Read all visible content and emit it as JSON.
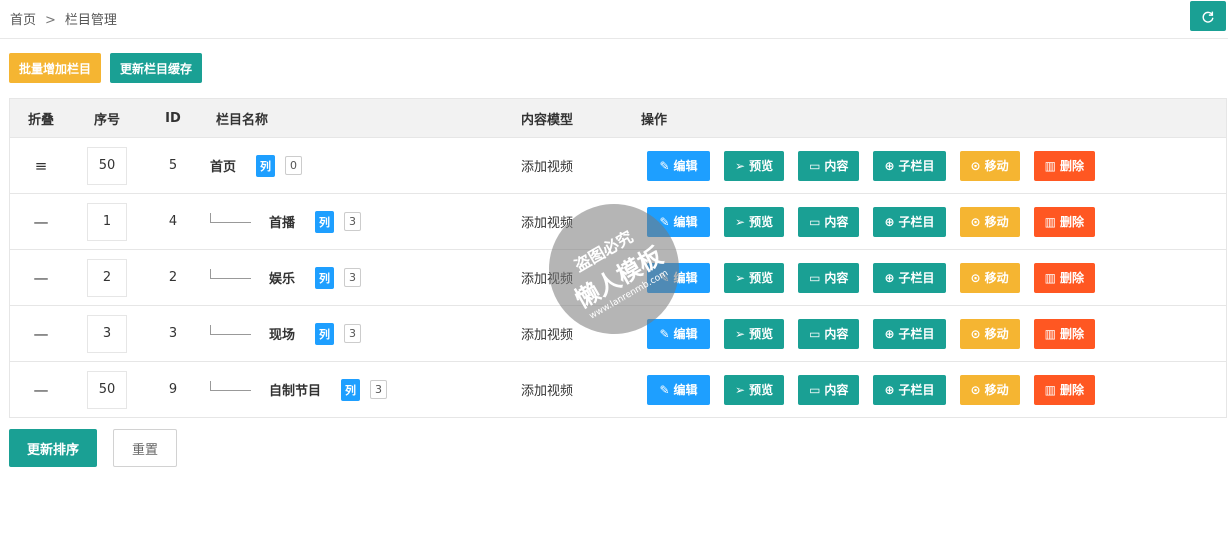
{
  "breadcrumb": {
    "home": "首页",
    "separator": ">",
    "current": "栏目管理"
  },
  "toolbar": {
    "batch_add": "批量增加栏目",
    "refresh_cache": "更新栏目缓存"
  },
  "table": {
    "headers": {
      "fold": "折叠",
      "order": "序号",
      "id": "ID",
      "name": "栏目名称",
      "model": "内容模型",
      "ops": "操作"
    },
    "rows": [
      {
        "fold": "≡",
        "order": "50",
        "id": "5",
        "name": "首页",
        "tag": "列",
        "count": "0",
        "model": "添加视频",
        "child": false
      },
      {
        "fold": "—",
        "order": "1",
        "id": "4",
        "name": "首播",
        "tag": "列",
        "count": "3",
        "model": "添加视频",
        "child": true
      },
      {
        "fold": "—",
        "order": "2",
        "id": "2",
        "name": "娱乐",
        "tag": "列",
        "count": "3",
        "model": "添加视频",
        "child": true
      },
      {
        "fold": "—",
        "order": "3",
        "id": "3",
        "name": "现场",
        "tag": "列",
        "count": "3",
        "model": "添加视频",
        "child": true
      },
      {
        "fold": "—",
        "order": "50",
        "id": "9",
        "name": "自制节目",
        "tag": "列",
        "count": "3",
        "model": "添加视频",
        "child": true
      }
    ]
  },
  "ops": {
    "edit": "编辑",
    "preview": "预览",
    "content": "内容",
    "sub": "子栏目",
    "move": "移动",
    "delete": "删除"
  },
  "bottom": {
    "update_sort": "更新排序",
    "reset": "重置"
  },
  "watermark": {
    "line1": "盗图必究",
    "line2": "懒人模板",
    "line3": "www.lanrenmb.com"
  },
  "colors": {
    "green": "#1aa094",
    "blue": "#1e9fff",
    "yellow": "#f5b532",
    "red": "#ff5722"
  }
}
